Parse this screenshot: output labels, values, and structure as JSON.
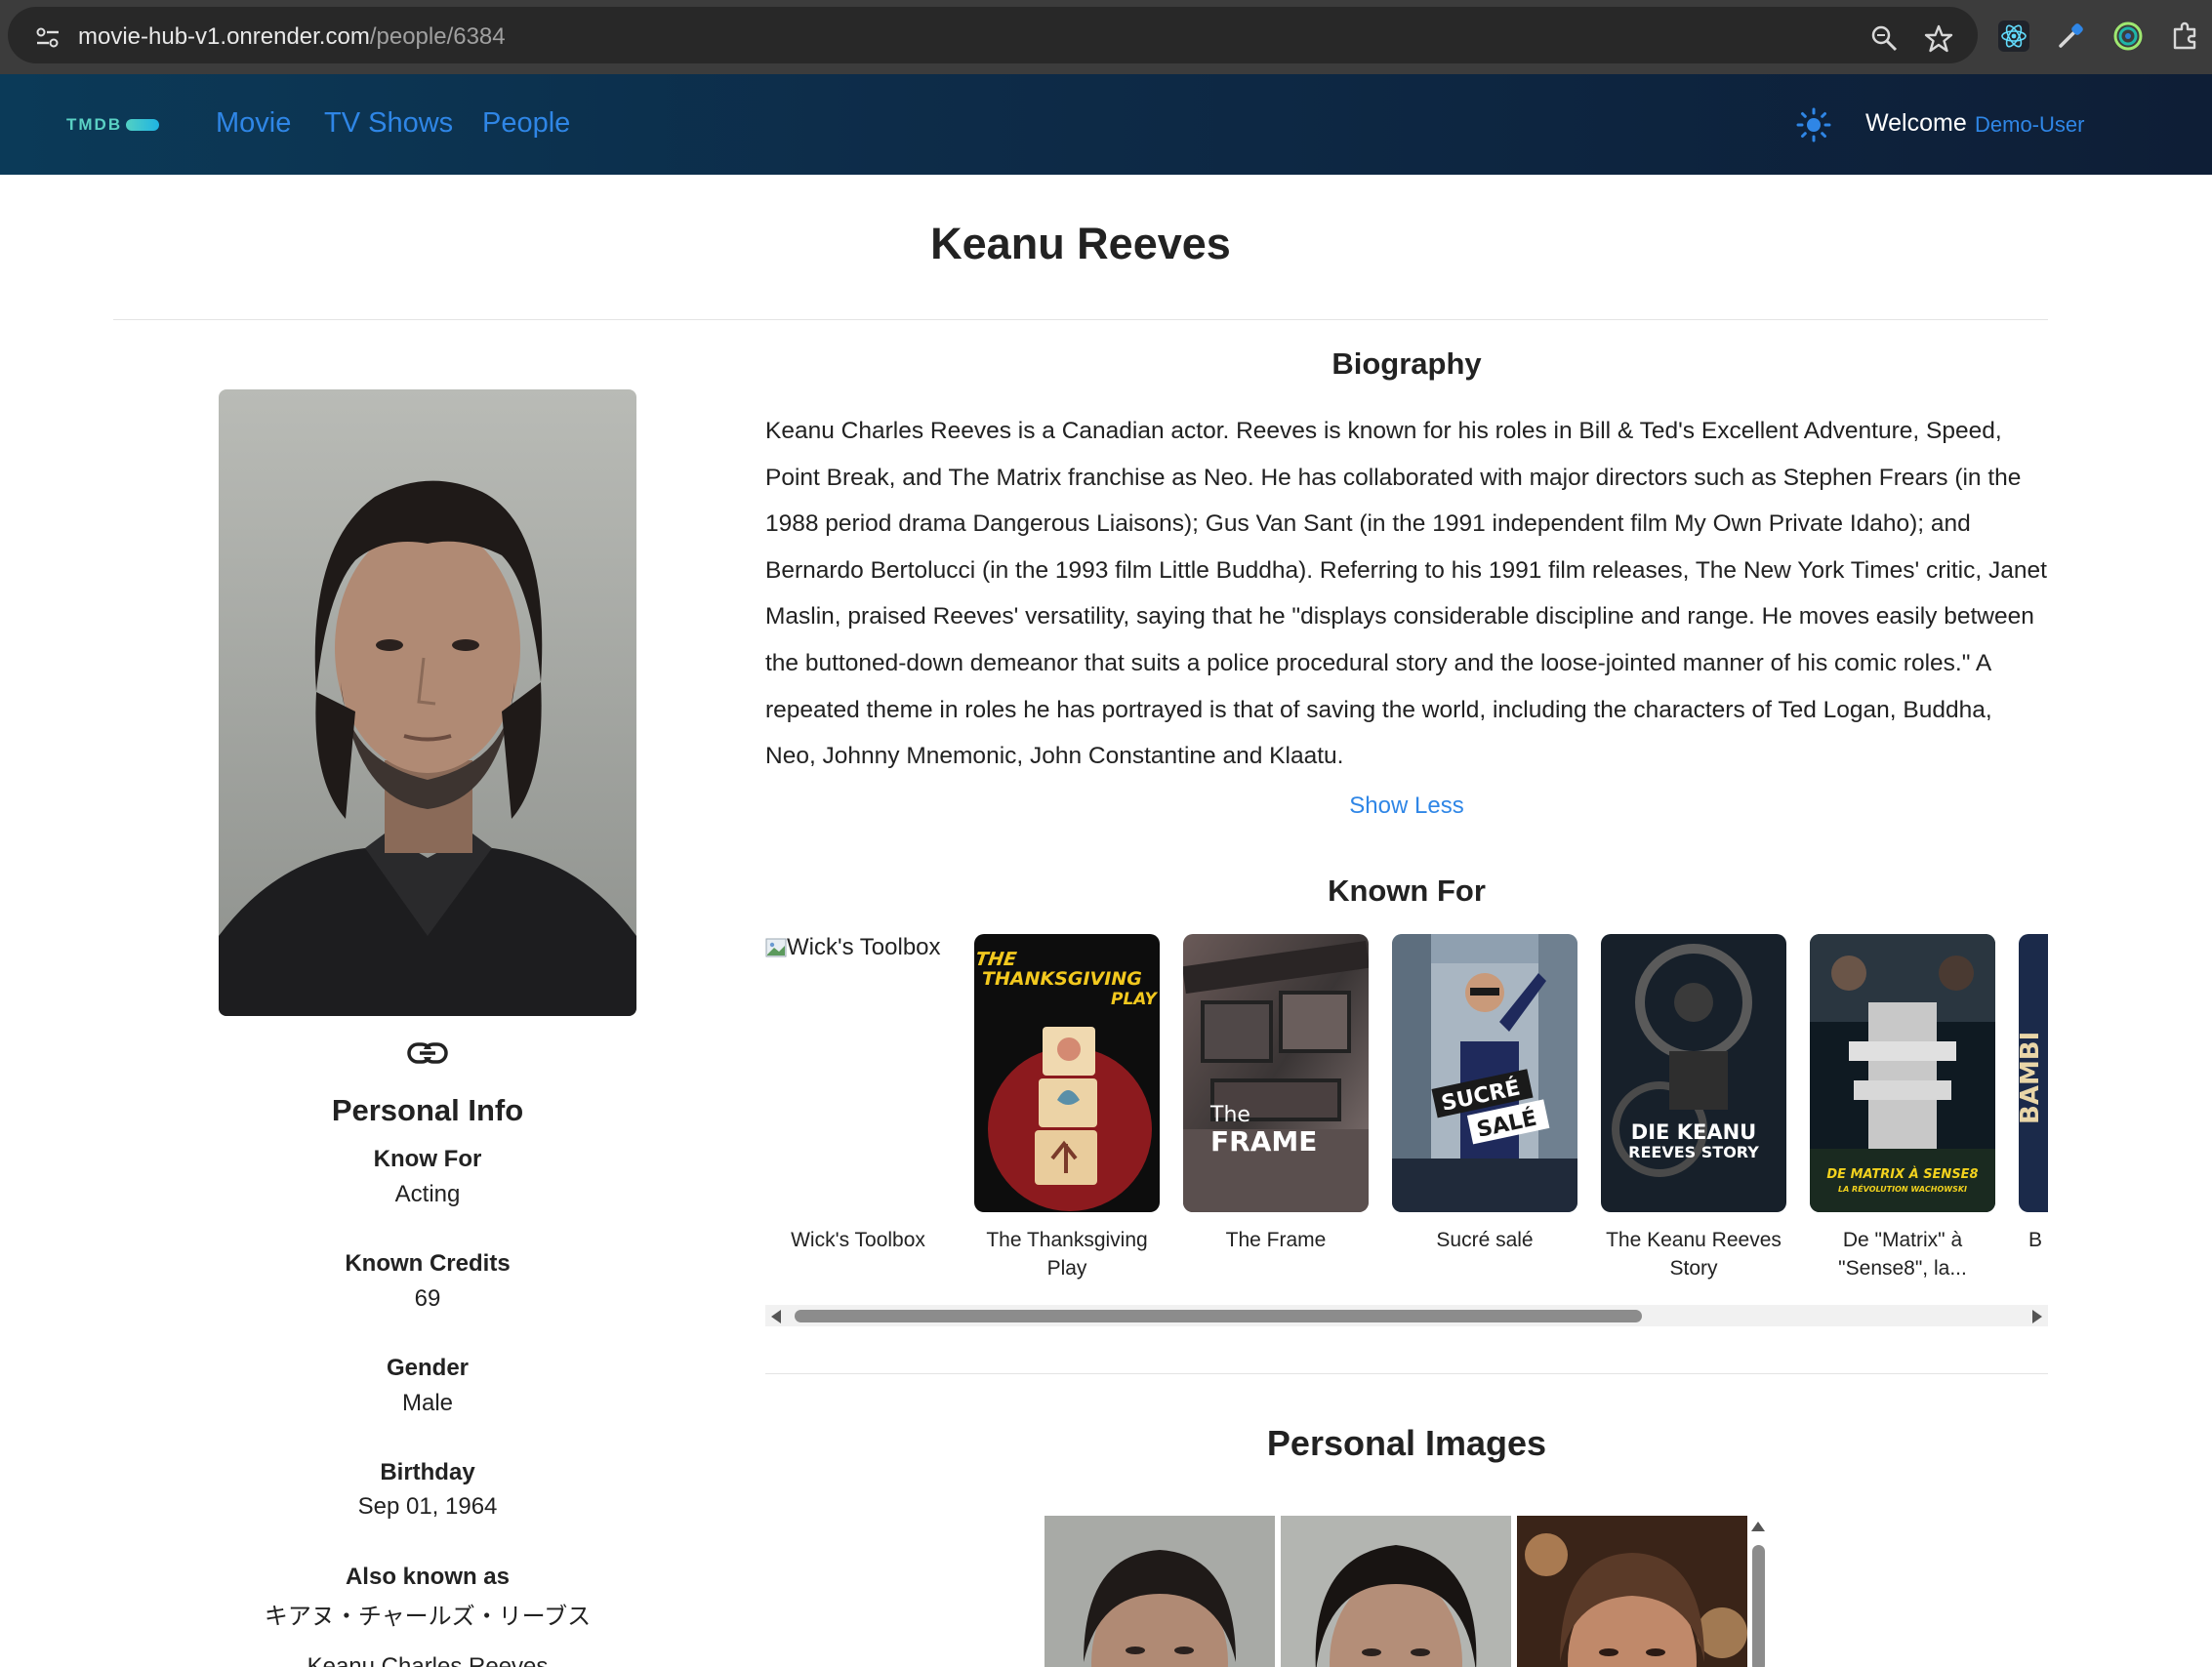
{
  "browser": {
    "url_host": "movie-hub-v1.onrender.com",
    "url_path": "/people/6384"
  },
  "nav": {
    "logo": "TMDB",
    "links": [
      "Movie",
      "TV Shows",
      "People"
    ],
    "welcome": "Welcome",
    "user": "Demo-User"
  },
  "person": {
    "name": "Keanu Reeves"
  },
  "personal_info": {
    "heading": "Personal Info",
    "fields": [
      {
        "label": "Know For",
        "value": "Acting"
      },
      {
        "label": "Known Credits",
        "value": "69"
      },
      {
        "label": "Gender",
        "value": "Male"
      },
      {
        "label": "Birthday",
        "value": "Sep 01, 1964"
      },
      {
        "label": "Also known as",
        "value": "キアヌ・チャールズ・リーブス"
      }
    ],
    "aka_more": "Keanu Charles Reeves"
  },
  "biography": {
    "heading": "Biography",
    "text": "Keanu Charles Reeves is a Canadian actor. Reeves is known for his roles in Bill & Ted's Excellent Adventure, Speed, Point Break, and The Matrix franchise as Neo. He has collaborated with major directors such as Stephen Frears (in the 1988 period drama Dangerous Liaisons); Gus Van Sant (in the 1991 independent film My Own Private Idaho); and Bernardo Bertolucci (in the 1993 film Little Buddha). Referring to his 1991 film releases, The New York Times' critic, Janet Maslin, praised Reeves' versatility, saying that he \"displays considerable discipline and range. He moves easily between the buttoned-down demeanor that suits a police procedural story and the loose-jointed manner of his comic roles.\" A repeated theme in roles he has portrayed is that of saving the world, including the characters of Ted Logan, Buddha, Neo, Johnny Mnemonic, John Constantine and Klaatu.",
    "toggle": "Show Less"
  },
  "known_for": {
    "heading": "Known For",
    "items": [
      {
        "title": "Wick's Toolbox",
        "alt": "Wick's Toolbox",
        "poster_text": ""
      },
      {
        "title": "The Thanksgiving Play",
        "poster_text": "THE THANKSGIVING PLAY"
      },
      {
        "title": "The Frame",
        "poster_text": "The FRAME"
      },
      {
        "title": "Sucré salé",
        "poster_text": "SUCRÉ SALÉ"
      },
      {
        "title": "The Keanu Reeves Story",
        "poster_text": "DIE KEANU REEVES STORY"
      },
      {
        "title": "De \"Matrix\" à \"Sense8\", la...",
        "poster_text": "DE MATRIX À SENSE8",
        "poster_subtext": "LA RÉVOLUTION WACHOWSKI"
      },
      {
        "title": "B",
        "poster_text": "BAMBI"
      }
    ]
  },
  "personal_images": {
    "heading": "Personal Images"
  }
}
